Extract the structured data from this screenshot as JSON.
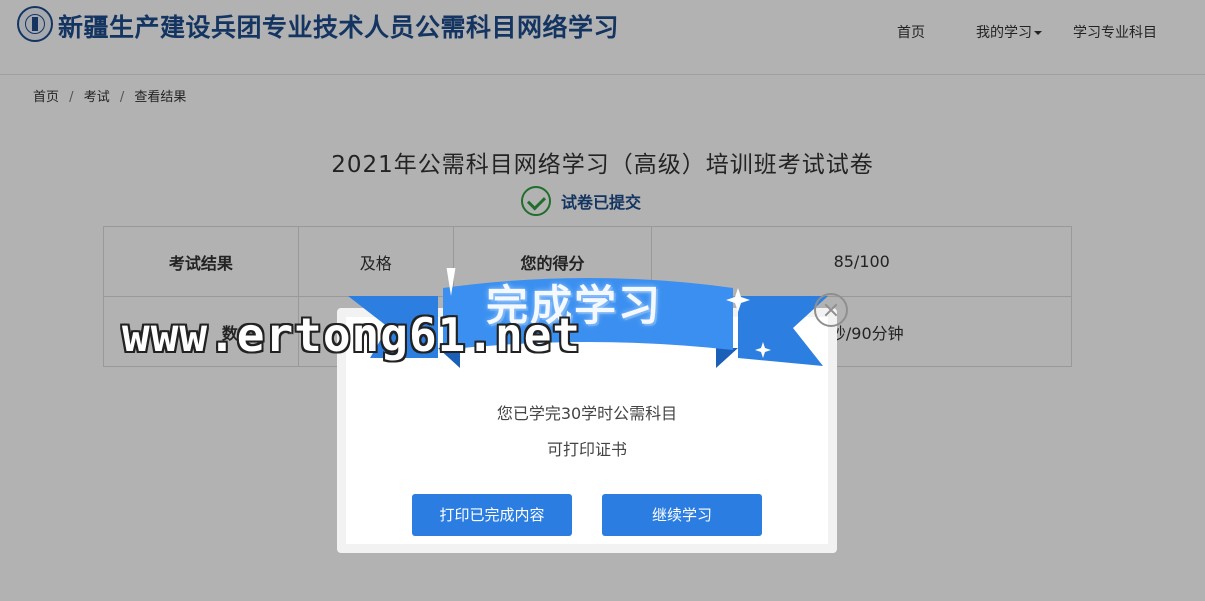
{
  "header": {
    "site_title": "新疆生产建设兵团专业技术人员公需科目网络学习",
    "nav": {
      "home": "首页",
      "my_learning": "我的学习",
      "subjects": "学习专业科目"
    }
  },
  "breadcrumb": {
    "home": "首页",
    "exam": "考试",
    "current": "查看结果",
    "separator": "/"
  },
  "exam": {
    "title": "2021年公需科目网络学习（高级）培训班考试试卷",
    "status": "试卷已提交"
  },
  "result_table": {
    "row1": {
      "label1": "考试结果",
      "value1": "及格",
      "label2": "您的得分",
      "value2": "85/100"
    },
    "row2": {
      "label1": "数",
      "value2": "7秒/90分钟"
    }
  },
  "modal": {
    "banner_title": "完成学习",
    "line1": "您已学完30学时公需科目",
    "line2": "可打印证书",
    "print_button": "打印已完成内容",
    "continue_button": "继续学习"
  },
  "watermark": "www.ertong61.net",
  "colors": {
    "brand": "#1e4d8c",
    "button": "#2b7de1",
    "ribbon": "#2c7fe0",
    "check": "#2e9e3e"
  }
}
